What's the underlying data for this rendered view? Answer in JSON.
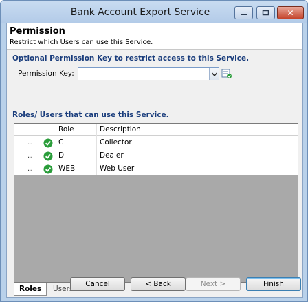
{
  "window": {
    "title": "Bank Account Export Service",
    "close_glyph": "✕"
  },
  "header": {
    "title": "Permission",
    "subtitle": "Restrict which Users can use this Service."
  },
  "permission": {
    "section_label": "Optional Permission Key to restrict access to this Service.",
    "key_label": "Permission Key:",
    "key_value": ""
  },
  "roles": {
    "section_label": "Roles/ Users that can use this Service.",
    "columns": {
      "role": "Role",
      "description": "Description"
    },
    "rows": [
      {
        "role": "C",
        "description": "Collector"
      },
      {
        "role": "D",
        "description": "Dealer"
      },
      {
        "role": "WEB",
        "description": "Web User"
      }
    ],
    "row_marker": "..."
  },
  "tabs": [
    {
      "label": "Roles",
      "active": true
    },
    {
      "label": "Users",
      "active": false
    }
  ],
  "buttons": {
    "cancel": "Cancel",
    "back": "< Back",
    "next": "Next >",
    "finish": "Finish"
  },
  "colors": {
    "section_text": "#1a3d7c",
    "check_green": "#2a9d3a",
    "grid_empty": "#a9a9a9"
  }
}
